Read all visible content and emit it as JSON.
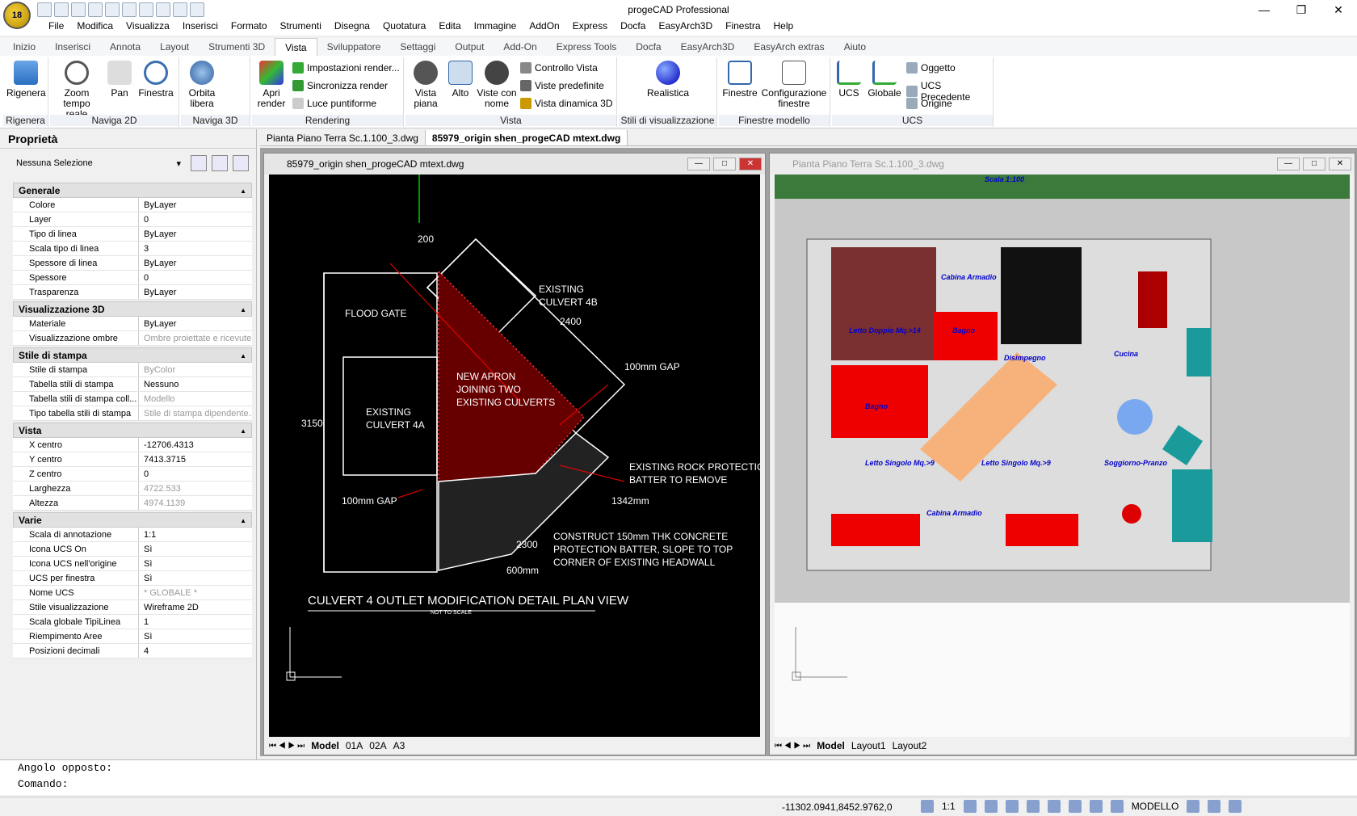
{
  "title": "progeCAD Professional",
  "menu": [
    "File",
    "Modifica",
    "Visualizza",
    "Inserisci",
    "Formato",
    "Strumenti",
    "Disegna",
    "Quotatura",
    "Edita",
    "Immagine",
    "AddOn",
    "Express",
    "Docfa",
    "EasyArch3D",
    "Finestra",
    "Help"
  ],
  "ribbon_tabs": [
    "Inizio",
    "Inserisci",
    "Annota",
    "Layout",
    "Strumenti 3D",
    "Vista",
    "Sviluppatore",
    "Settaggi",
    "Output",
    "Add-On",
    "Express Tools",
    "Docfa",
    "EasyArch3D",
    "EasyArch extras",
    "Aiuto"
  ],
  "ribbon": {
    "rigenera": {
      "btn": "Rigenera",
      "group": "Rigenera"
    },
    "naviga2d": {
      "zoom": "Zoom tempo reale",
      "pan": "Pan",
      "finestra": "Finestra",
      "group": "Naviga 2D"
    },
    "naviga3d": {
      "orbita": "Orbita libera",
      "group": "Naviga 3D"
    },
    "rendering": {
      "apri": "Apri render",
      "imp": "Impostazioni render...",
      "sync": "Sincronizza render",
      "luce": "Luce puntiforme",
      "group": "Rendering"
    },
    "vista": {
      "piana": "Vista piana",
      "alto": "Alto",
      "nome": "Viste con nome",
      "ctrl": "Controllo Vista",
      "pred": "Viste predefinite",
      "din": "Vista dinamica 3D",
      "group": "Vista"
    },
    "stili": {
      "real": "Realistica",
      "group": "Stili di visualizzazione"
    },
    "finestre": {
      "fin": "Finestre",
      "conf": "Configurazione finestre",
      "group": "Finestre modello"
    },
    "ucs": {
      "ucs": "UCS",
      "glob": "Globale",
      "ogg": "Oggetto",
      "prec": "UCS Precedente",
      "orig": "Origine",
      "group": "UCS"
    }
  },
  "panel": {
    "title": "Proprietà",
    "selection": "Nessuna Selezione",
    "sections": [
      {
        "name": "Generale",
        "rows": [
          [
            "Colore",
            "ByLayer"
          ],
          [
            "Layer",
            "0"
          ],
          [
            "Tipo di linea",
            "ByLayer"
          ],
          [
            "Scala tipo di linea",
            "3"
          ],
          [
            "Spessore di linea",
            "ByLayer"
          ],
          [
            "Spessore",
            "0"
          ],
          [
            "Trasparenza",
            "ByLayer"
          ]
        ]
      },
      {
        "name": "Visualizzazione 3D",
        "rows": [
          [
            "Materiale",
            "ByLayer"
          ],
          [
            "Visualizzazione ombre",
            "Ombre proiettate e ricevute"
          ]
        ]
      },
      {
        "name": "Stile di stampa",
        "rows": [
          [
            "Stile di stampa",
            "ByColor"
          ],
          [
            "Tabella stili di stampa",
            "Nessuno"
          ],
          [
            "Tabella stili di stampa coll...",
            "Modello"
          ],
          [
            "Tipo tabella stili di stampa",
            "Stile di stampa dipendente..."
          ]
        ]
      },
      {
        "name": "Vista",
        "rows": [
          [
            "X centro",
            "-12706.4313"
          ],
          [
            "Y centro",
            "7413.3715"
          ],
          [
            "Z centro",
            "0"
          ],
          [
            "Larghezza",
            "4722.533"
          ],
          [
            "Altezza",
            "4974.1139"
          ]
        ]
      },
      {
        "name": "Varie",
        "rows": [
          [
            "Scala di annotazione",
            "1:1"
          ],
          [
            "Icona UCS On",
            "Sì"
          ],
          [
            "Icona UCS nell'origine",
            "Sì"
          ],
          [
            "UCS per finestra",
            "Sì"
          ],
          [
            "Nome UCS",
            "* GLOBALE *"
          ],
          [
            "Stile visualizzazione",
            "Wireframe 2D"
          ],
          [
            "Scala globale TipiLinea",
            "1"
          ],
          [
            "Riempimento Aree",
            "Sì"
          ],
          [
            "Posizioni decimali",
            "4"
          ]
        ]
      }
    ]
  },
  "doc_tabs": [
    "Pianta Piano Terra Sc.1.100_3.dwg",
    "85979_origin shen_progeCAD mtext.dwg"
  ],
  "win1": {
    "title": "85979_origin shen_progeCAD mtext.dwg",
    "tabs": [
      "Model",
      "01A",
      "02A",
      "A3"
    ],
    "labels": {
      "dim200": "200",
      "flood": "FLOOD GATE",
      "ex4b1": "EXISTING",
      "ex4b2": "CULVERT 4B",
      "d2400": "2400",
      "gap1": "100mm GAP",
      "apron1": "NEW APRON",
      "apron2": "JOINING TWO",
      "apron3": "EXISTING CULVERTS",
      "ex4a1": "EXISTING",
      "ex4a2": "CULVERT 4A",
      "d3150": "3150",
      "rock1": "EXISTING ROCK PROTECTION",
      "rock2": "BATTER TO REMOVE",
      "gap2": "100mm GAP",
      "d1342": "1342mm",
      "c1": "CONSTRUCT 150mm THK CONCRETE",
      "c2": "PROTECTION BATTER, SLOPE TO TOP",
      "c3": "CORNER OF EXISTING HEADWALL",
      "d2300": "2300",
      "d600": "600mm",
      "heading": "CULVERT 4 OUTLET MODIFICATION DETAIL PLAN VIEW",
      "nts": "NOT TO SCALE"
    }
  },
  "win2": {
    "title": "Pianta Piano Terra Sc.1.100_3.dwg",
    "tabs": [
      "Model",
      "Layout1",
      "Layout2"
    ],
    "labels": {
      "scala": "Scala 1:100",
      "cab1": "Cabina Armadio",
      "letto1": "Letto Doppio Mq.>14",
      "bagno1": "Bagno",
      "dis": "Disimpegno",
      "cucina": "Cucina",
      "bagno2": "Bagno",
      "ls1": "Letto Singolo Mq.>9",
      "ls2": "Letto Singolo Mq.>9",
      "sog": "Soggiorno-Pranzo",
      "cab2": "Cabina Armadio"
    }
  },
  "command": {
    "line1": "Angolo opposto:",
    "line2": "Comando:"
  },
  "status": {
    "coords": "-11302.0941,8452.9762,0",
    "scale": "1:1",
    "mode": "MODELLO"
  }
}
